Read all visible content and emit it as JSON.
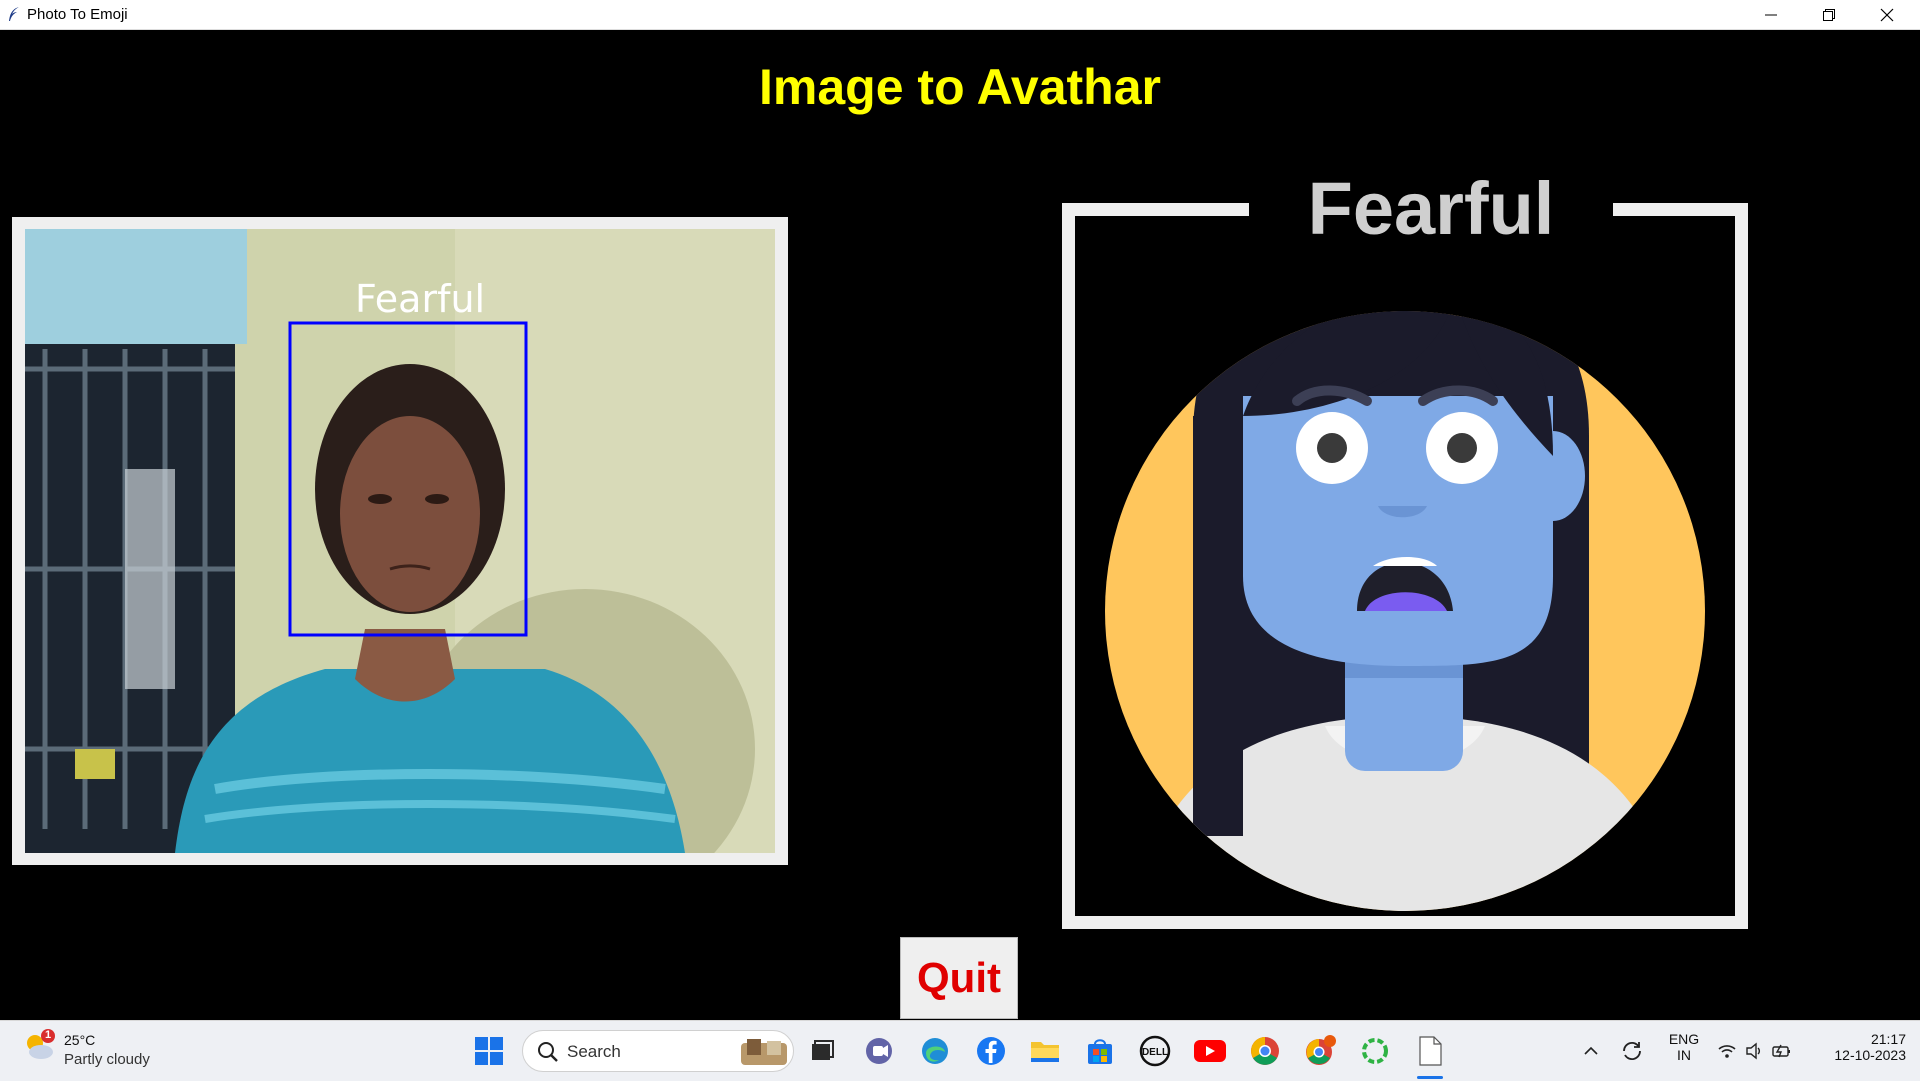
{
  "window": {
    "title": "Photo To Emoji",
    "minimize_label": "Minimize",
    "restore_label": "Restore",
    "close_label": "Close"
  },
  "app": {
    "heading": "Image to Avathar",
    "camera": {
      "face_label": "Fearful"
    },
    "avatar": {
      "emotion_label": "Fearful"
    },
    "quit_label": "Quit"
  },
  "colors": {
    "heading": "#ffff00",
    "quit_text": "#e00000",
    "face_box": "#0000ff",
    "avatar_circle": "#ffc65c",
    "avatar_skin": "#7fa9e6",
    "avatar_hair": "#1b1b2b"
  },
  "taskbar": {
    "weather": {
      "badge": "1",
      "temp": "25°C",
      "desc": "Partly cloudy",
      "icon": "partly-cloudy-icon"
    },
    "search_placeholder": "Search",
    "pinned": [
      "start-icon",
      "search-icon",
      "widgets-image",
      "task-view-icon",
      "teams-icon",
      "edge-icon",
      "facebook-icon",
      "file-explorer-icon",
      "store-icon",
      "dell-icon",
      "youtube-icon",
      "chrome-icon",
      "chrome-profile-icon",
      "app-icon",
      "notepad-icon"
    ],
    "tray": {
      "lang_line1": "ENG",
      "lang_line2": "IN",
      "time": "21:17",
      "date": "12-10-2023"
    }
  }
}
